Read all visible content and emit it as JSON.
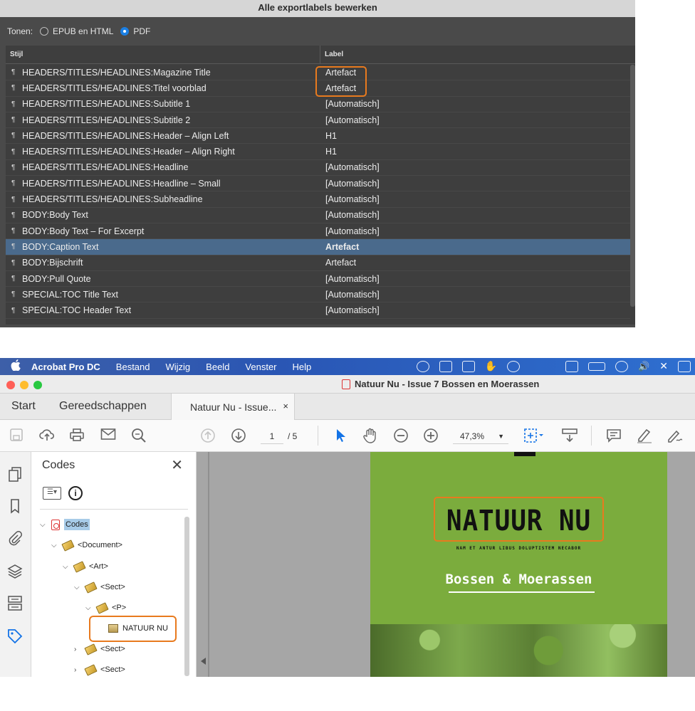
{
  "dialog": {
    "title": "Alle exportlabels bewerken",
    "show_label": "Tonen:",
    "radio_epub": "EPUB en HTML",
    "radio_pdf": "PDF",
    "col_style": "Stijl",
    "col_label": "Label",
    "pilcrow": "¶",
    "rows": [
      {
        "style": "HEADERS/TITLES/HEADLINES:Magazine Title",
        "label": "Artefact"
      },
      {
        "style": "HEADERS/TITLES/HEADLINES:Titel voorblad",
        "label": "Artefact"
      },
      {
        "style": "HEADERS/TITLES/HEADLINES:Subtitle 1",
        "label": "[Automatisch]"
      },
      {
        "style": "HEADERS/TITLES/HEADLINES:Subtitle 2",
        "label": "[Automatisch]"
      },
      {
        "style": "HEADERS/TITLES/HEADLINES:Header – Align Left",
        "label": "H1"
      },
      {
        "style": "HEADERS/TITLES/HEADLINES:Header – Align Right",
        "label": "H1"
      },
      {
        "style": "HEADERS/TITLES/HEADLINES:Headline",
        "label": "[Automatisch]"
      },
      {
        "style": "HEADERS/TITLES/HEADLINES:Headline – Small",
        "label": "[Automatisch]"
      },
      {
        "style": "HEADERS/TITLES/HEADLINES:Subheadline",
        "label": "[Automatisch]"
      },
      {
        "style": "BODY:Body Text",
        "label": "[Automatisch]"
      },
      {
        "style": "BODY:Body Text – For Excerpt",
        "label": "[Automatisch]"
      },
      {
        "style": "BODY:Caption Text",
        "label": "Artefact",
        "selected": true
      },
      {
        "style": "BODY:Bijschrift",
        "label": "Artefact"
      },
      {
        "style": "BODY:Pull Quote",
        "label": "[Automatisch]"
      },
      {
        "style": "SPECIAL:TOC Title Text",
        "label": "[Automatisch]"
      },
      {
        "style": "SPECIAL:TOC Header Text",
        "label": "[Automatisch]"
      }
    ]
  },
  "menubar": {
    "apple": "",
    "items": [
      "Acrobat Pro DC",
      "Bestand",
      "Wijzig",
      "Beeld",
      "Venster",
      "Help"
    ]
  },
  "window": {
    "title": "Natuur Nu - Issue 7 Bossen en Moerassen"
  },
  "tabs": {
    "home": "Start",
    "tools": "Gereedschappen",
    "doc": "Natuur Nu - Issue...",
    "close": "×"
  },
  "toolbar": {
    "page_current": "1",
    "page_total": "/ 5",
    "zoom": "47,3%"
  },
  "panel": {
    "title": "Codes",
    "close": "✕",
    "info": "i",
    "tree": [
      {
        "text": "Codes",
        "level": 0,
        "icon": "pdf-icon",
        "chev": "⌵",
        "selected": true
      },
      {
        "text": "<Document>",
        "level": 1,
        "icon": "tag-icon",
        "chev": "⌵"
      },
      {
        "text": "<Art>",
        "level": 2,
        "icon": "tag-icon",
        "chev": "⌵"
      },
      {
        "text": "<Sect>",
        "level": 3,
        "icon": "tag-icon",
        "chev": "⌵"
      },
      {
        "text": "<P>",
        "level": 4,
        "icon": "tag-icon",
        "chev": "⌵"
      },
      {
        "text": "NATUUR NU",
        "level": 5,
        "icon": "content-box-icon",
        "chev": ""
      },
      {
        "text": "<Sect>",
        "level": 3,
        "icon": "tag-icon",
        "chev": "›"
      },
      {
        "text": "<Sect>",
        "level": 3,
        "icon": "tag-icon",
        "chev": "›"
      }
    ]
  },
  "page": {
    "title": "NATUUR NU",
    "tagline": "NAM ET ANTUR LIBUS DOLUPTISTEM NECABOR",
    "subtitle": "Bossen & Moerassen"
  },
  "colors": {
    "highlight": "#e87a1e",
    "selection_row": "#4a6a8c",
    "page_green": "#7bac3d",
    "accent_blue": "#1473e6"
  }
}
